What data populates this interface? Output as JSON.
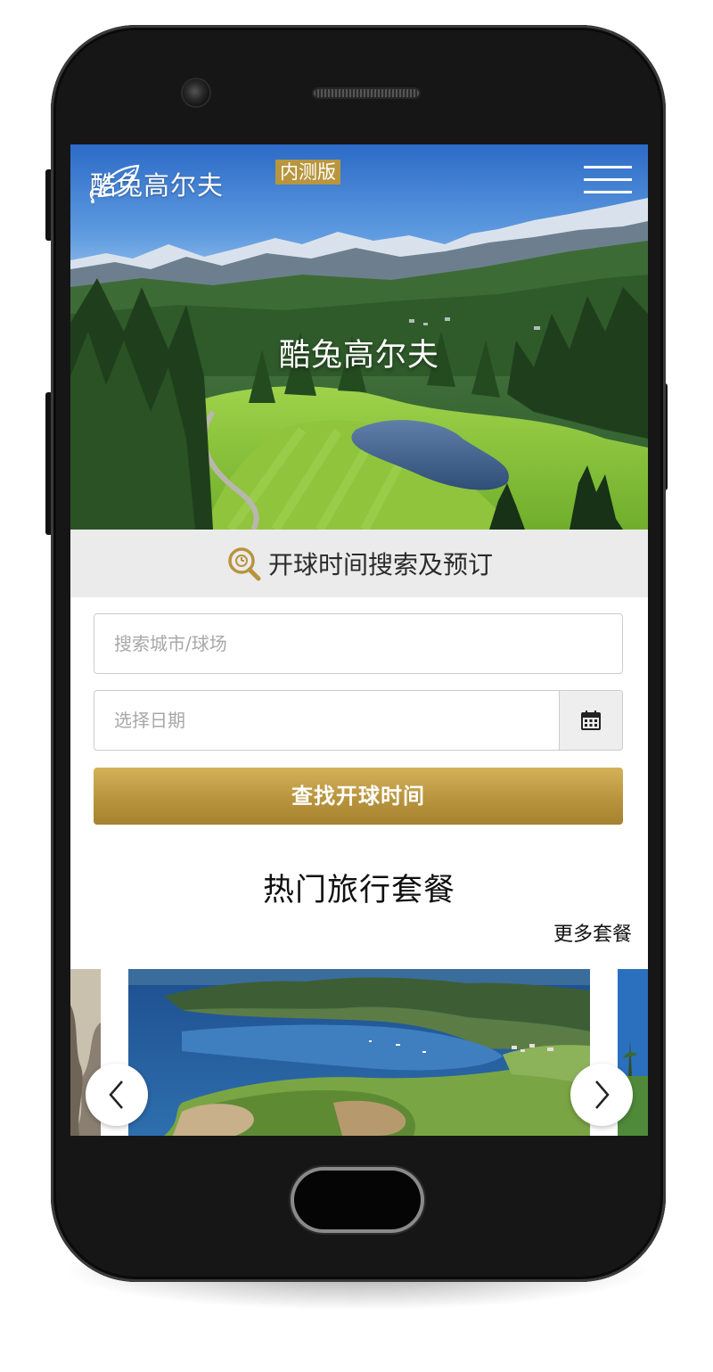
{
  "header": {
    "logo_text": "酷兔高尔夫",
    "beta_badge": "内测版",
    "menu_icon": "hamburger-menu-icon"
  },
  "hero": {
    "title": "酷兔高尔夫"
  },
  "search": {
    "section_title": "开球时间搜索及预订",
    "section_icon": "clock-search-icon",
    "city_placeholder": "搜索城市/球场",
    "date_placeholder": "选择日期",
    "calendar_icon": "calendar-icon",
    "submit_label": "查找开球时间"
  },
  "packages": {
    "section_title": "热门旅行套餐",
    "more_label": "更多套餐",
    "prev_icon": "chevron-left-icon",
    "next_icon": "chevron-right-icon"
  },
  "colors": {
    "accent_gold": "#b8963e",
    "band_gray": "#ebebec",
    "phone_body": "#111111"
  }
}
